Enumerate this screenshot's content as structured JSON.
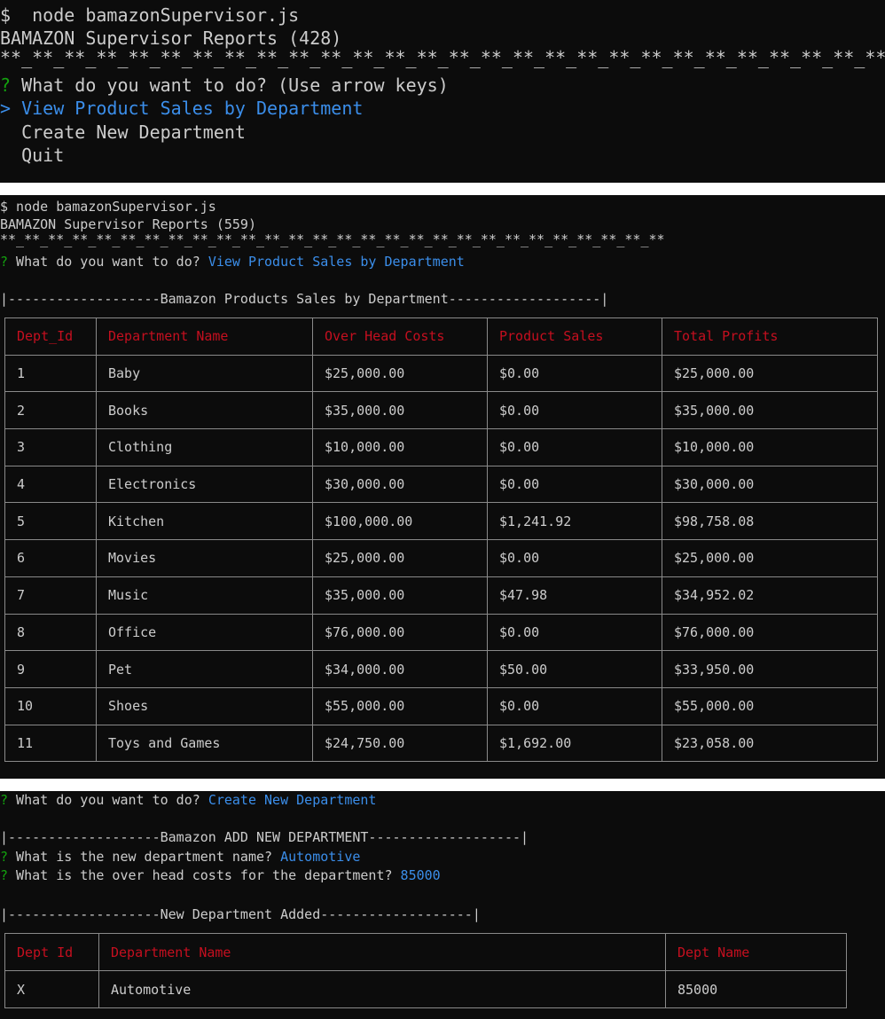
{
  "panel1": {
    "command": "$  node bamazonSupervisor.js",
    "title": "BAMAZON Supervisor Reports (428)",
    "stars": "**_**_**_**_**_**_**_**_**_**_**_**_**_**_**_**_**_**_**_**_**_**_**_**_**_**_**_**_**",
    "prompt_mark": "?",
    "prompt": " What do you want to do? (Use arrow keys)",
    "menu": [
      {
        "label": "> View Product Sales by Department"
      },
      {
        "label": "  Create New Department"
      },
      {
        "label": "  Quit"
      }
    ]
  },
  "panel2": {
    "command": "$ node bamazonSupervisor.js",
    "title": "BAMAZON Supervisor Reports (559)",
    "stars": "**_**_**_**_**_**_**_**_**_**_**_**_**_**_**_**_**_**_**_**_**_**_**_**_**_**_**_**",
    "prompt_mark": "?",
    "prompt": " What do you want to do? ",
    "answer": "View Product Sales by Department",
    "banner": "|-------------------Bamazon Products Sales by Department-------------------|",
    "headers": [
      "Dept_Id",
      "Department Name",
      "Over Head Costs",
      "Product Sales",
      "Total Profits"
    ],
    "rows": [
      [
        "1",
        "Baby",
        "$25,000.00",
        "$0.00",
        "$25,000.00"
      ],
      [
        "2",
        "Books",
        "$35,000.00",
        "$0.00",
        "$35,000.00"
      ],
      [
        "3",
        "Clothing",
        "$10,000.00",
        "$0.00",
        "$10,000.00"
      ],
      [
        "4",
        "Electronics",
        "$30,000.00",
        "$0.00",
        "$30,000.00"
      ],
      [
        "5",
        "Kitchen",
        "$100,000.00",
        "$1,241.92",
        "$98,758.08"
      ],
      [
        "6",
        "Movies",
        "$25,000.00",
        "$0.00",
        "$25,000.00"
      ],
      [
        "7",
        "Music",
        "$35,000.00",
        "$47.98",
        "$34,952.02"
      ],
      [
        "8",
        "Office",
        "$76,000.00",
        "$0.00",
        "$76,000.00"
      ],
      [
        "9",
        "Pet",
        "$34,000.00",
        "$50.00",
        "$33,950.00"
      ],
      [
        "10",
        "Shoes",
        "$55,000.00",
        "$0.00",
        "$55,000.00"
      ],
      [
        "11",
        "Toys and Games",
        "$24,750.00",
        "$1,692.00",
        "$23,058.00"
      ]
    ]
  },
  "panel3": {
    "prompt_mark": "?",
    "prompt": " What do you want to do? ",
    "answer": "Create New Department",
    "banner": "|-------------------Bamazon ADD NEW DEPARTMENT-------------------|",
    "q1": " What is the new department name? ",
    "a1": "Automotive",
    "q2": " What is the over head costs for the department? ",
    "a2": "85000",
    "added_banner": "|-------------------New Department Added-------------------|",
    "headers": [
      "Dept Id",
      "Department Name",
      "Dept Name"
    ],
    "rows": [
      [
        "X",
        "Automotive",
        "85000"
      ]
    ]
  },
  "colors": {
    "background": "#0c0c0c",
    "text": "#cccccc",
    "prompt": "#13a10e",
    "highlight": "#3b8eea",
    "header": "#c50f1f",
    "border": "#8a8a8a"
  }
}
